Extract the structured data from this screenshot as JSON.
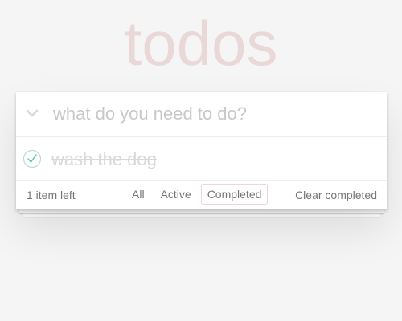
{
  "app": {
    "title": "todos"
  },
  "input": {
    "placeholder": "what do you need to do?"
  },
  "todos": [
    {
      "label": "wash the dog",
      "completed": true
    }
  ],
  "footer": {
    "count_text": "1 item left",
    "filters": [
      {
        "label": "All",
        "selected": false
      },
      {
        "label": "Active",
        "selected": false
      },
      {
        "label": "Completed",
        "selected": true
      }
    ],
    "clear_label": "Clear completed"
  },
  "colors": {
    "title": "#e6d5d5",
    "check_green": "#5dc2af",
    "placeholder": "#c8c8c8"
  },
  "icons": {
    "toggle_all": "chevron-down-icon",
    "todo_check": "checkmark-circle-icon"
  }
}
